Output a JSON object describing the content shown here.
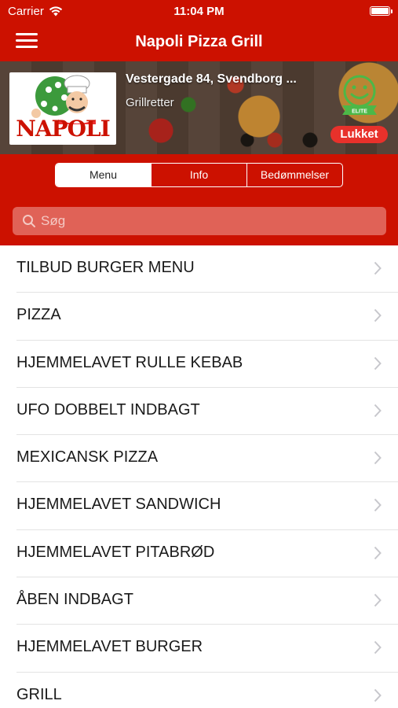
{
  "statusbar": {
    "carrier": "Carrier",
    "time": "11:04 PM"
  },
  "navbar": {
    "title": "Napoli Pizza Grill"
  },
  "restaurant": {
    "logo_text": "NAPOLI",
    "address": "Vestergade 84, Svendborg ...",
    "category": "Grillretter",
    "status": "Lukket"
  },
  "tabs": [
    {
      "label": "Menu",
      "active": true
    },
    {
      "label": "Info",
      "active": false
    },
    {
      "label": "Bedømmelser",
      "active": false
    }
  ],
  "search": {
    "placeholder": "Søg"
  },
  "menu_items": [
    {
      "label": "TILBUD BURGER MENU"
    },
    {
      "label": "PIZZA"
    },
    {
      "label": "HJEMMELAVET RULLE KEBAB"
    },
    {
      "label": "UFO DOBBELT INDBAGT"
    },
    {
      "label": "MEXICANSK PIZZA"
    },
    {
      "label": "HJEMMELAVET SANDWICH"
    },
    {
      "label": "HJEMMELAVET PITABRØD"
    },
    {
      "label": "ÅBEN INDBAGT"
    },
    {
      "label": "HJEMMELAVET BURGER"
    },
    {
      "label": "GRILL"
    }
  ],
  "colors": {
    "brand_red": "#cc1100",
    "status_red": "#e8312b",
    "smiley_green": "#4cb848"
  },
  "icons": [
    "wifi-icon",
    "battery-icon",
    "hamburger-menu-icon",
    "chef-logo",
    "elite-smiley-icon",
    "search-icon",
    "chevron-right-icon"
  ]
}
